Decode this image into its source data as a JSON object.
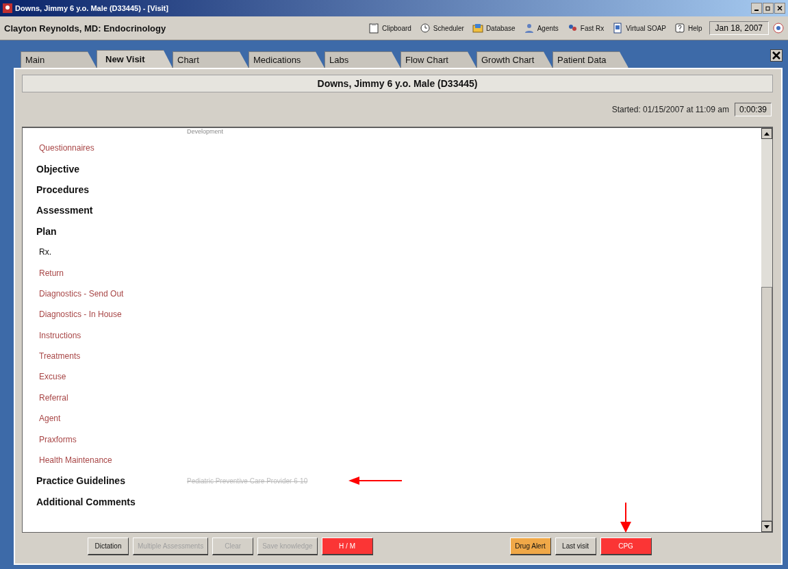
{
  "window": {
    "title": "Downs, Jimmy 6 y.o. Male (D33445)  - [Visit]"
  },
  "header": {
    "provider": "Clayton Reynolds, MD: Endocrinology",
    "date": "Jan 18, 2007"
  },
  "toolbar": [
    {
      "label": "Clipboard",
      "kind": "clipboard"
    },
    {
      "label": "Scheduler",
      "kind": "scheduler"
    },
    {
      "label": "Database",
      "kind": "database"
    },
    {
      "label": "Agents",
      "kind": "agents"
    },
    {
      "label": "Fast Rx",
      "kind": "fastrx"
    },
    {
      "label": "Virtual SOAP",
      "kind": "soap"
    },
    {
      "label": "Help",
      "kind": "help"
    }
  ],
  "tabs": [
    {
      "label": "Main",
      "selected": false
    },
    {
      "label": "New Visit",
      "selected": true
    },
    {
      "label": "Chart",
      "selected": false
    },
    {
      "label": "Medications",
      "selected": false
    },
    {
      "label": "Labs",
      "selected": false
    },
    {
      "label": "Flow Chart",
      "selected": false
    },
    {
      "label": "Growth Chart",
      "selected": false
    },
    {
      "label": "Patient Data",
      "selected": false
    }
  ],
  "patient_banner": "Downs, Jimmy 6 y.o. Male (D33445)",
  "started": "Started: 01/15/2007 at 11:09 am",
  "timer": "0:00:39",
  "outline_top_note": "Development",
  "outline": [
    {
      "label": "Questionnaires",
      "kind": "link"
    },
    {
      "label": "Objective",
      "kind": "heading"
    },
    {
      "label": "Procedures",
      "kind": "heading"
    },
    {
      "label": "Assessment",
      "kind": "heading"
    },
    {
      "label": "Plan",
      "kind": "heading"
    },
    {
      "label": "Rx.",
      "kind": "plain"
    },
    {
      "label": "Return",
      "kind": "link"
    },
    {
      "label": "Diagnostics - Send Out",
      "kind": "link"
    },
    {
      "label": "Diagnostics - In House",
      "kind": "link"
    },
    {
      "label": "Instructions",
      "kind": "link"
    },
    {
      "label": "Treatments",
      "kind": "link"
    },
    {
      "label": "Excuse",
      "kind": "link"
    },
    {
      "label": "Referral",
      "kind": "link"
    },
    {
      "label": "Agent",
      "kind": "link"
    },
    {
      "label": "Praxforms",
      "kind": "link"
    },
    {
      "label": "Health Maintenance",
      "kind": "link"
    },
    {
      "label": "Practice Guidelines",
      "kind": "heading",
      "note": "Pediatric Preventive Care Provider 6-10",
      "arrow": true
    },
    {
      "label": "Additional Comments",
      "kind": "heading"
    }
  ],
  "buttons_left": [
    {
      "label": "Dictation",
      "kind": "normal"
    },
    {
      "label": "Multiple Assessments",
      "kind": "disabled"
    },
    {
      "label": "Clear",
      "kind": "disabled"
    },
    {
      "label": "Save knowledge",
      "kind": "disabled"
    },
    {
      "label": "H / M",
      "kind": "red"
    }
  ],
  "buttons_right": [
    {
      "label": "Drug Alert",
      "kind": "orange"
    },
    {
      "label": "Last visit",
      "kind": "normal"
    },
    {
      "label": "CPG",
      "kind": "red",
      "arrow": true
    }
  ]
}
